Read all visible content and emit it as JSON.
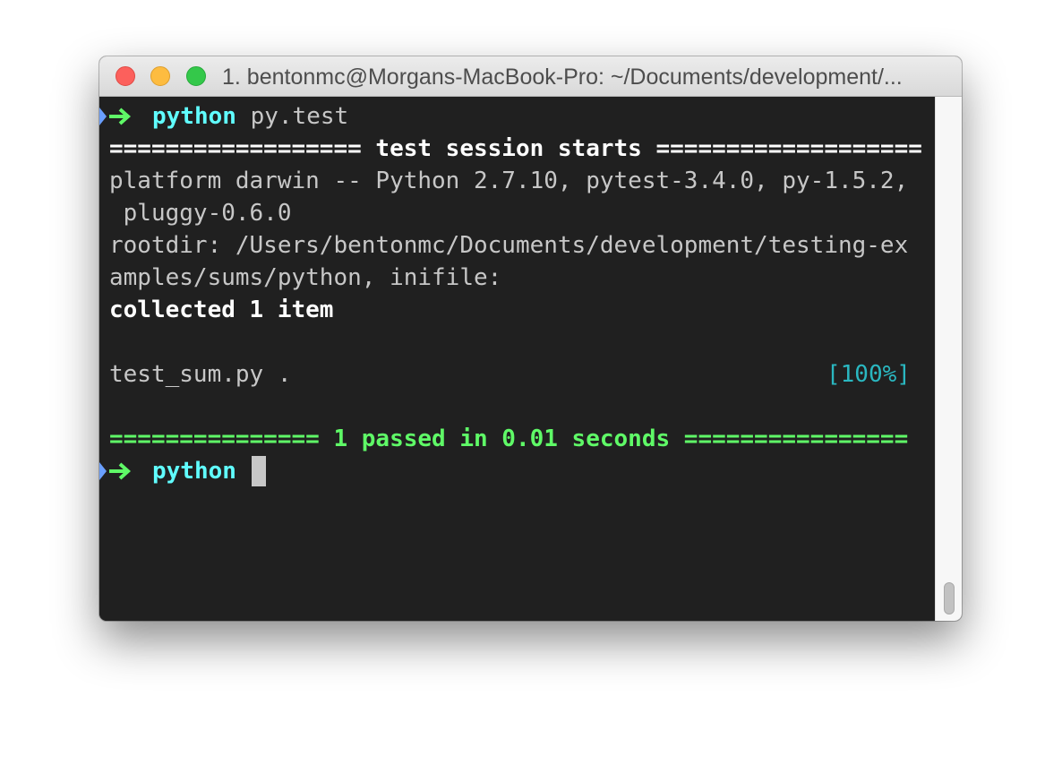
{
  "window": {
    "title": "1. bentonmc@Morgans-MacBook-Pro: ~/Documents/development/..."
  },
  "terminal": {
    "prompt1": {
      "dir": "python",
      "command": "py.test"
    },
    "session_header": "================== test session starts ===================",
    "platform_line1": "platform darwin -- Python 2.7.10, pytest-3.4.0, py-1.5.2,",
    "platform_line2": " pluggy-0.6.0",
    "rootdir_line1": "rootdir: /Users/bentonmc/Documents/development/testing-ex",
    "rootdir_line2": "amples/sums/python, inifile:",
    "collected": "collected 1 item",
    "test_file": "test_sum.py .",
    "progress": "[100%]",
    "result_line": "=============== 1 passed in 0.01 seconds ================",
    "prompt2": {
      "dir": "python"
    }
  },
  "colors": {
    "background": "#202020",
    "text": "#c7c7c7",
    "bold": "#ffffff",
    "green": "#5ff967",
    "cyan": "#60fdff",
    "progress": "#2ab7c0",
    "prompt_blue": "#6a9fff"
  }
}
